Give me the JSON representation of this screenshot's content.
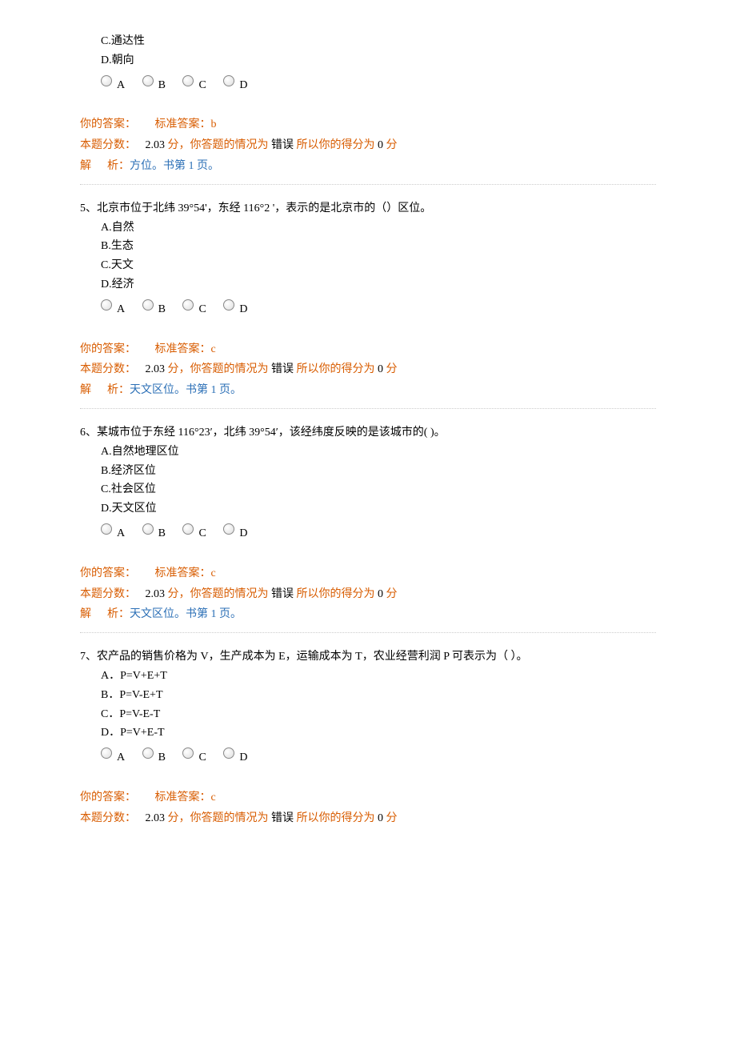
{
  "ui": {
    "your_answer_label": "你的答案：",
    "std_answer_label": "标准答案：",
    "score_label": "本题分数：",
    "score_unit": "分，你答题的情况为",
    "result_text": "错误",
    "so_score_prefix": "所以你的得分为",
    "so_score_value": "0",
    "so_score_unit": "分",
    "explain_label": "解",
    "explain_label2": "析：",
    "radio_labels": [
      "A",
      "B",
      "C",
      "D"
    ]
  },
  "questions": [
    {
      "partial_options": [
        "C.通达性",
        "D.朝向"
      ],
      "std_answer": "b",
      "score": "2.03",
      "explain": "方位。书第 1 页。"
    },
    {
      "number": "5、",
      "text": "北京市位于北纬 39°54'，东经 116°2 '，表示的是北京市的（）区位。",
      "options": [
        "A.自然",
        "B.生态",
        "C.天文",
        "D.经济"
      ],
      "std_answer": "c",
      "score": "2.03",
      "explain": "天文区位。书第 1 页。"
    },
    {
      "number": "6、",
      "text": "某城市位于东经 116°23′，北纬 39°54′，该经纬度反映的是该城市的(         )。",
      "options": [
        "A.自然地理区位",
        "B.经济区位",
        "C.社会区位",
        "D.天文区位"
      ],
      "std_answer": "c",
      "score": "2.03",
      "explain": "天文区位。书第 1 页。"
    },
    {
      "number": "7、",
      "text": "农产品的销售价格为 V，生产成本为 E，运输成本为 T，农业经营利润 P 可表示为（       ）。",
      "options": [
        "A．P=V+E+T",
        "B．P=V-E+T",
        "C．P=V-E-T",
        "D．P=V+E-T"
      ],
      "std_answer": "c",
      "score": "2.03",
      "explain": ""
    }
  ]
}
